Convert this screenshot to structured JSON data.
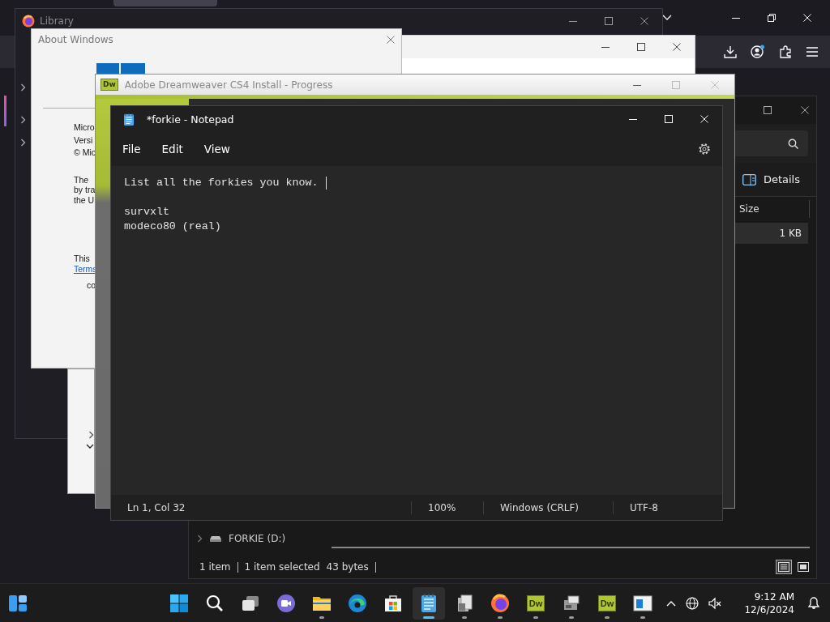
{
  "library": {
    "title": "Library"
  },
  "about_windows": {
    "title": "About Windows",
    "blocks": [
      [
        "Micro",
        "Versi",
        "© Mic"
      ],
      [
        "The",
        "by tra",
        "the U"
      ],
      [
        "This"
      ]
    ],
    "link": "Terms",
    "footer": "co"
  },
  "dreamweaver": {
    "title": "Adobe Dreamweaver CS4 Install - Progress",
    "logo": "Dw"
  },
  "explorer": {
    "toolbar_button": "Details",
    "column": "Size",
    "row_size": "1 KB",
    "nav_item": "FORKIE (D:)",
    "status": [
      "1 item",
      "1 item selected",
      "43 bytes"
    ],
    "views": [
      {
        "kind": "details",
        "selected": true
      },
      {
        "kind": "tiles",
        "selected": false
      }
    ]
  },
  "notepad": {
    "title": "*forkie - Notepad",
    "menu": [
      "File",
      "Edit",
      "View"
    ],
    "paragraphs": [
      {
        "lines": [
          {
            "text": "List all the forkies you know.",
            "cursor": true
          }
        ]
      },
      {
        "lines": [
          {
            "text": "survxlt",
            "cursor": false
          },
          {
            "text": "modeco80 (real)",
            "cursor": false
          }
        ]
      }
    ],
    "status": [
      "Ln 1, Col 32",
      "100%",
      "Windows (CRLF)",
      "UTF-8"
    ]
  },
  "taskbar": {
    "apps": [
      {
        "kind": "start",
        "running": false,
        "selected": false
      },
      {
        "kind": "search",
        "running": false,
        "selected": false
      },
      {
        "kind": "taskview",
        "running": false,
        "selected": false
      },
      {
        "kind": "chat",
        "running": false,
        "selected": false
      },
      {
        "kind": "folder",
        "running": true,
        "selected": false
      },
      {
        "kind": "edge",
        "running": false,
        "selected": false
      },
      {
        "kind": "store",
        "running": false,
        "selected": false
      },
      {
        "kind": "notepad",
        "running": true,
        "selected": true
      },
      {
        "kind": "installer",
        "running": true,
        "selected": false
      },
      {
        "kind": "firefox",
        "running": true,
        "selected": false
      },
      {
        "kind": "dw",
        "label": "Dw",
        "running": true,
        "selected": false
      },
      {
        "kind": "setup",
        "running": true,
        "selected": false
      },
      {
        "kind": "dw",
        "label": "Dw",
        "running": true,
        "selected": false
      },
      {
        "kind": "window",
        "running": true,
        "selected": false
      }
    ],
    "time": "9:12 AM",
    "date": "12/6/2024"
  }
}
